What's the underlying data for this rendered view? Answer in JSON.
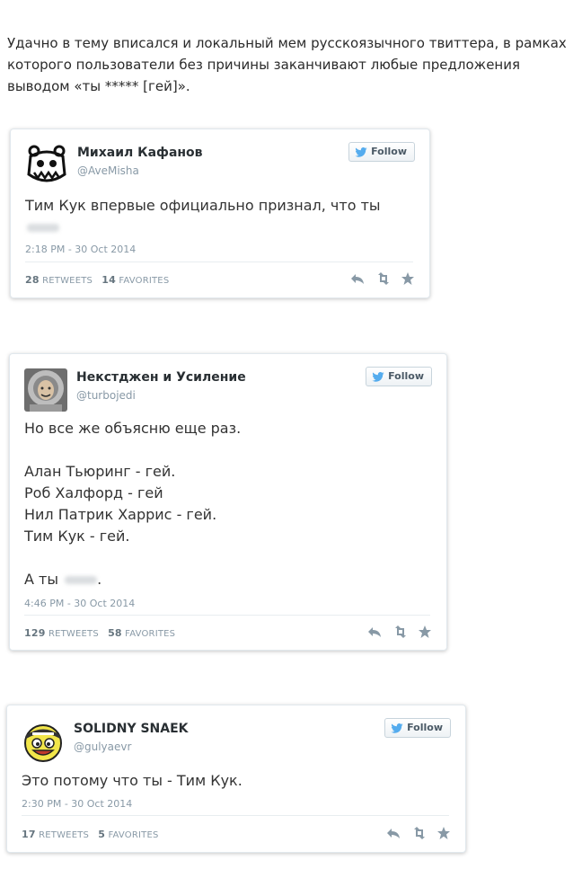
{
  "intro": "Удачно в тему вписался и локальный мем русскоязычного твиттера, в рамках которого пользователи без причины заканчивают любые предложения выводом «ты ***** [гей]».",
  "tweets": [
    {
      "name": "Михаил Кафанов",
      "handle": "@AveMisha",
      "follow": "Follow",
      "lines": [
        "Тим Кук впервые официально признал, что ты"
      ],
      "last_prefix": "",
      "last_suffix": "",
      "timestamp": "2:18 PM - 30 Oct 2014",
      "retweets": "28",
      "retweets_label": "RETWEETS",
      "favorites": "14",
      "favorites_label": "FAVORITES",
      "avatar_icon": "radiohead-bear-icon"
    },
    {
      "name": "Некстджен и Усиление",
      "handle": "@turbojedi",
      "follow": "Follow",
      "lines": [
        "Но все же объясню еще раз.",
        "",
        "Алан Тьюринг - гей.",
        "Роб Халфорд - гей",
        "Нил Патрик Харрис - гей.",
        "Тим Кук - гей.",
        ""
      ],
      "last_prefix": "А ты",
      "last_suffix": ".",
      "timestamp": "4:46 PM - 30 Oct 2014",
      "retweets": "129",
      "retweets_label": "RETWEETS",
      "favorites": "58",
      "favorites_label": "FAVORITES",
      "avatar_icon": "cosmonaut-photo-icon"
    },
    {
      "name": "SOLIDNY SNAEK",
      "handle": "@gulyaevr",
      "follow": "Follow",
      "lines": [
        "Это потому что ты - Тим Кук."
      ],
      "last_prefix": "",
      "last_suffix": "",
      "timestamp": "2:30 PM - 30 Oct 2014",
      "retweets": "17",
      "retweets_label": "RETWEETS",
      "favorites": "5",
      "favorites_label": "FAVORITES",
      "avatar_icon": "bandana-face-icon"
    }
  ],
  "colors": {
    "name": "#292f33",
    "meta": "#8899a6",
    "bird": "#55acee"
  }
}
